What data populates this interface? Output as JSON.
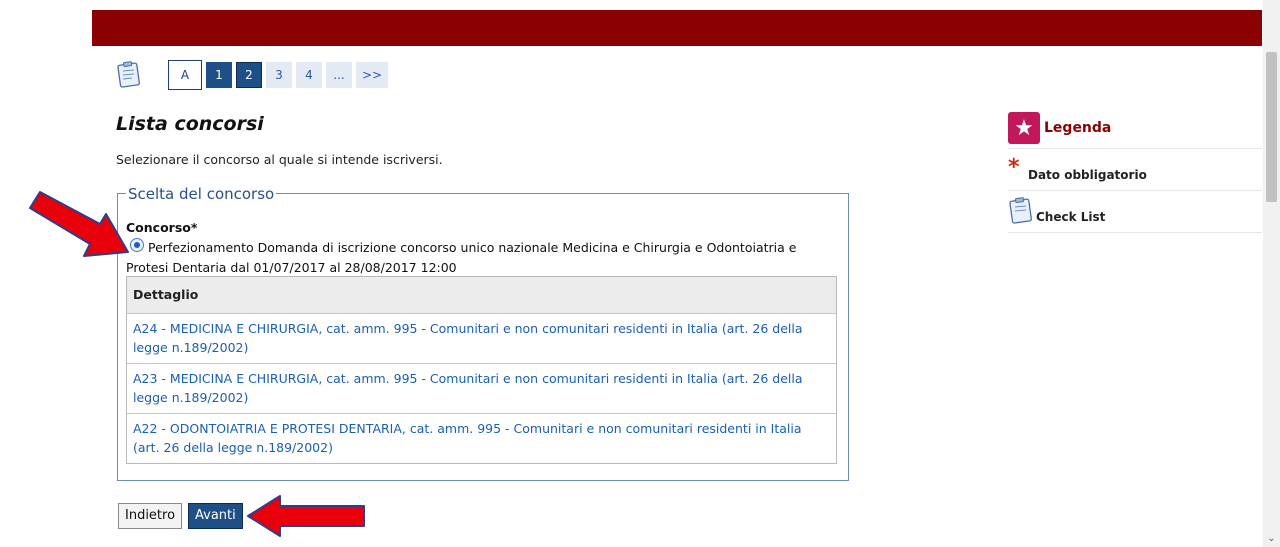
{
  "steps": [
    "A",
    "1",
    "2",
    "3",
    "4",
    "...",
    ">>"
  ],
  "page": {
    "title": "Lista concorsi",
    "intro": "Selezionare il concorso al quale si intende iscriversi."
  },
  "section": {
    "legend": "Scelta del concorso",
    "field_label": "Concorso*",
    "option_text": "Perfezionamento Domanda di iscrizione concorso unico nazionale Medicina e Chirurgia e Odontoiatria e Protesi Dentaria dal 01/07/2017 al 28/08/2017 12:00",
    "option_selected": true
  },
  "detail": {
    "header": "Dettaglio",
    "rows": [
      "A24 - MEDICINA E CHIRURGIA, cat. amm. 995 - Comunitari e non comunitari residenti in Italia (art. 26 della legge n.189/2002)",
      "A23 - MEDICINA E CHIRURGIA, cat. amm. 995 - Comunitari e non comunitari residenti in Italia (art. 26 della legge n.189/2002)",
      "A22 - ODONTOIATRIA E PROTESI DENTARIA, cat. amm. 995 - Comunitari e non comunitari residenti in Italia (art. 26 della legge n.189/2002)"
    ]
  },
  "buttons": {
    "back": "Indietro",
    "next": "Avanti"
  },
  "sidebar": {
    "title": "Legenda",
    "items": [
      {
        "icon": "asterisk-icon",
        "label": "Dato obbligatorio"
      },
      {
        "icon": "clipboard-icon",
        "label": "Check List"
      }
    ]
  },
  "colors": {
    "header_bar": "#8b0000",
    "accent_blue": "#1e4f86",
    "link_blue": "#1a5fb4",
    "legend_pink": "#c2185b",
    "annotation_arrow": "#e8000b"
  }
}
